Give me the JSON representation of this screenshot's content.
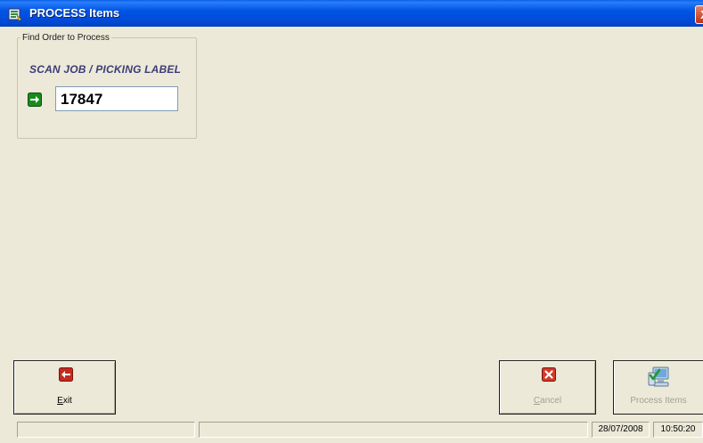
{
  "window": {
    "title": "PROCESS Items",
    "close_glyph": "X"
  },
  "find_group": {
    "legend": "Find Order to  Process",
    "scan_label": "SCAN JOB / PICKING LABEL",
    "order_input_value": "17847"
  },
  "buttons": {
    "exit": {
      "prefix": "",
      "mnemonic": "E",
      "rest": "xit",
      "icon": "red-left-arrow-icon",
      "enabled": true
    },
    "cancel": {
      "mnemonic": "C",
      "rest": "ancel",
      "icon": "red-x-icon",
      "enabled": false
    },
    "process": {
      "label": "Process Items",
      "icon": "computer-check-icon",
      "enabled": false
    }
  },
  "status_bar": {
    "panel1": "",
    "panel2": "",
    "date": "28/07/2008",
    "time": "10:50:20"
  },
  "colors": {
    "titlebar": "#0055e5",
    "face": "#ece9d8",
    "label_blue": "#3c3c78",
    "go_green": "#1b8a1b",
    "exit_red": "#c52a1e"
  }
}
